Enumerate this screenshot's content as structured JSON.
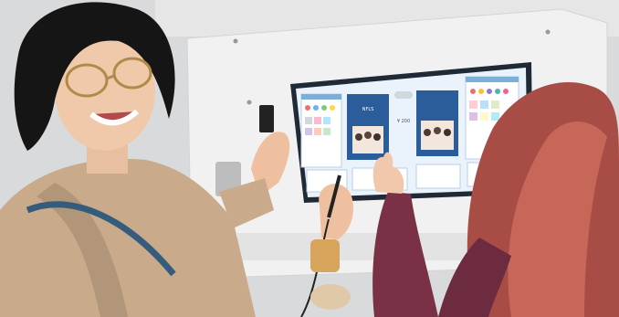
{
  "photo": {
    "kiosk_screen": {
      "title_text": "NFLS",
      "price_text": "¥ 200",
      "accent_color": "#2a5d9a",
      "panel_color": "#eaf3fb"
    }
  }
}
